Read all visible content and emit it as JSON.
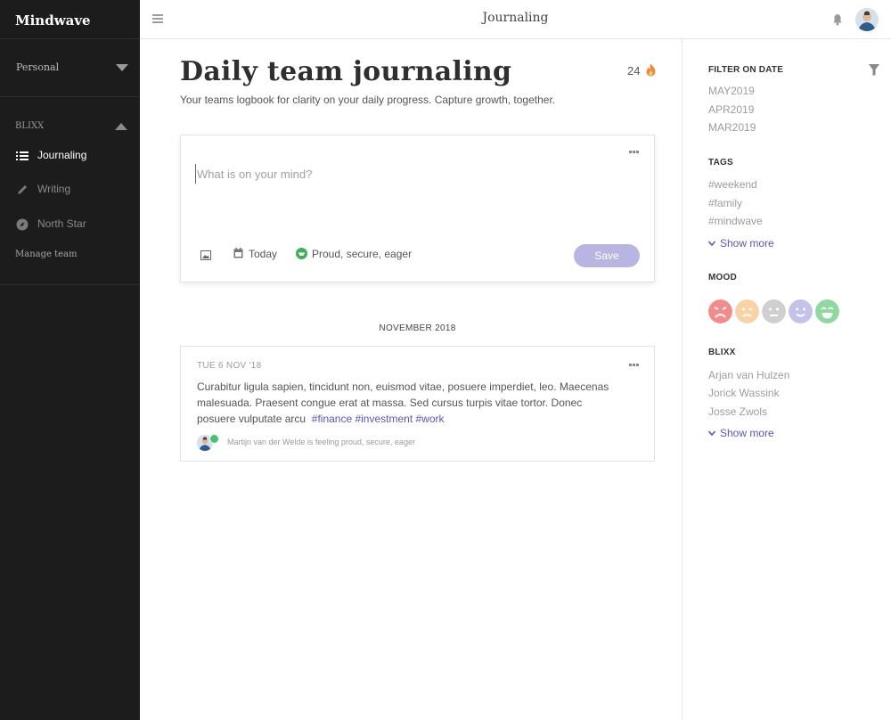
{
  "app": {
    "brand": "Mindwave",
    "top_title": "Journaling"
  },
  "sidebar": {
    "workspace": "Personal",
    "section": "BLIXX",
    "items": [
      {
        "label": "Journaling",
        "icon": "list-icon",
        "active": true
      },
      {
        "label": "Writing",
        "icon": "pencil-icon",
        "active": false
      },
      {
        "label": "North Star",
        "icon": "compass-icon",
        "active": false
      }
    ],
    "manage": "Manage team"
  },
  "main": {
    "title": "Daily team journaling",
    "subtitle": "Your teams logbook for clarity on your daily progress. Capture growth, together.",
    "streak": "24",
    "composer": {
      "placeholder": "What is on your mind?",
      "date": "Today",
      "mood": "Proud, secure, eager",
      "save": "Save"
    },
    "month_divider": "NOVEMBER 2018",
    "entry": {
      "date": "TUE 6 NOV '18",
      "body": "Curabitur ligula sapien, tincidunt non, euismod vitae, posuere imperdiet, leo. Maecenas malesuada. Praesent congue erat at massa. Sed cursus turpis vitae tortor. Donec posuere vulputate arcu",
      "tags": "#finance #investment #work",
      "footer": "Martijn van der Welde is feeling proud, secure, eager"
    }
  },
  "right_panel": {
    "filter_title": "FILTER ON DATE",
    "dates": [
      "MAY2019",
      "APR2019",
      "MAR2019"
    ],
    "tags_title": "TAGS",
    "tags": [
      "#weekend",
      "#family",
      "#mindwave"
    ],
    "show_more": "Show more",
    "mood_title": "MOOD",
    "moods": [
      {
        "name": "angry",
        "color": "#f28b8b"
      },
      {
        "name": "sad",
        "color": "#f7d3a6"
      },
      {
        "name": "neutral",
        "color": "#cfcfcf"
      },
      {
        "name": "content",
        "color": "#c4c2ea"
      },
      {
        "name": "happy",
        "color": "#8fd99f"
      }
    ],
    "team_title": "BLIXX",
    "members": [
      "Arjan van Hulzen",
      "Jorick Wassink",
      "Josse Zwols"
    ],
    "show_more_team": "Show more"
  },
  "colors": {
    "accent": "#5a57b8",
    "save_button": "#b9b5e2",
    "sidebar_bg": "#1c1c1c"
  }
}
